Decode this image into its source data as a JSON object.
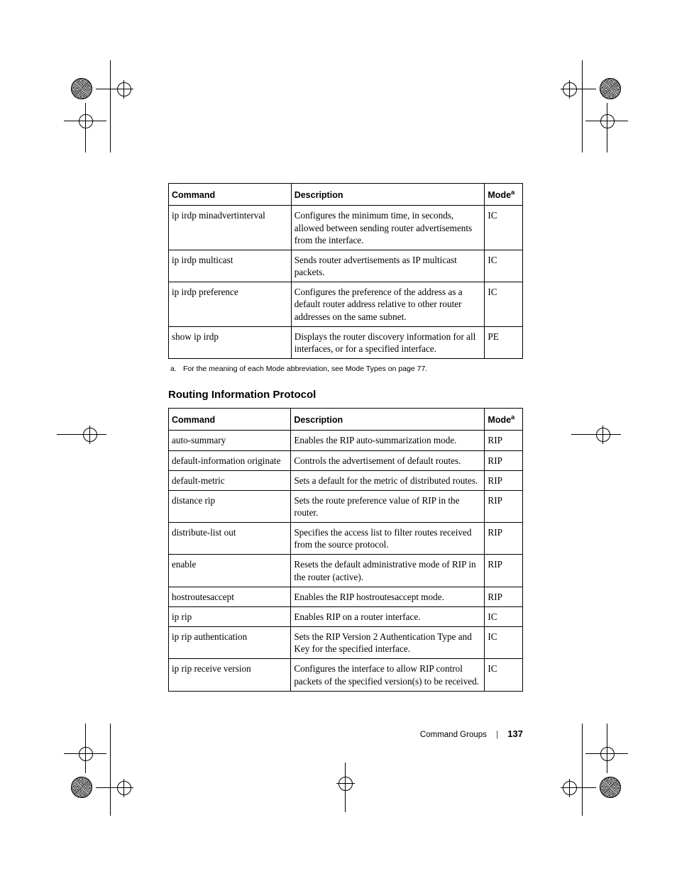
{
  "tables": {
    "first": {
      "headers": {
        "command": "Command",
        "description": "Description",
        "mode": "Mode",
        "mode_sup": "a"
      },
      "rows": [
        {
          "cmd": "ip irdp minadvertinterval",
          "desc": "Configures the minimum time, in seconds, allowed between sending router advertisements from the interface.",
          "mode": "IC"
        },
        {
          "cmd": "ip irdp multicast",
          "desc": "Sends router advertisements as IP multicast packets.",
          "mode": "IC"
        },
        {
          "cmd": "ip irdp preference",
          "desc": "Configures the preference of the address as a default router address relative to other router addresses on the same subnet.",
          "mode": "IC"
        },
        {
          "cmd": "show ip irdp",
          "desc": "Displays the router discovery information for all interfaces, or for a specified interface.",
          "mode": "PE"
        }
      ]
    },
    "second": {
      "headers": {
        "command": "Command",
        "description": "Description",
        "mode": "Mode",
        "mode_sup": "a"
      },
      "rows": [
        {
          "cmd": "auto-summary",
          "desc": "Enables the RIP auto-summarization mode.",
          "mode": "RIP"
        },
        {
          "cmd": "default-information originate",
          "desc": "Controls the advertisement of default routes.",
          "mode": "RIP"
        },
        {
          "cmd": "default-metric",
          "desc": "Sets a default for the metric of distributed routes.",
          "mode": "RIP"
        },
        {
          "cmd": "distance rip",
          "desc": "Sets the route preference value of RIP in the router.",
          "mode": "RIP"
        },
        {
          "cmd": "distribute-list out",
          "desc": "Specifies the access list to filter routes received from the source protocol.",
          "mode": "RIP"
        },
        {
          "cmd": "enable",
          "desc": "Resets the default administrative mode of RIP in the router (active).",
          "mode": "RIP"
        },
        {
          "cmd": "hostroutesaccept",
          "desc": "Enables the RIP hostroutesaccept mode.",
          "mode": "RIP"
        },
        {
          "cmd": "ip rip",
          "desc": "Enables RIP on a router interface.",
          "mode": "IC"
        },
        {
          "cmd": "ip rip authentication",
          "desc": "Sets the RIP Version 2 Authentication Type and Key for the specified interface.",
          "mode": "IC"
        },
        {
          "cmd": "ip rip receive version",
          "desc": "Configures the interface to allow RIP control packets of the specified version(s) to be received.",
          "mode": "IC"
        }
      ]
    }
  },
  "footnote": {
    "marker": "a.",
    "text": "For the meaning of each Mode abbreviation, see Mode Types on page 77."
  },
  "section_heading": "Routing Information Protocol",
  "footer": {
    "section": "Command Groups",
    "page": "137"
  }
}
